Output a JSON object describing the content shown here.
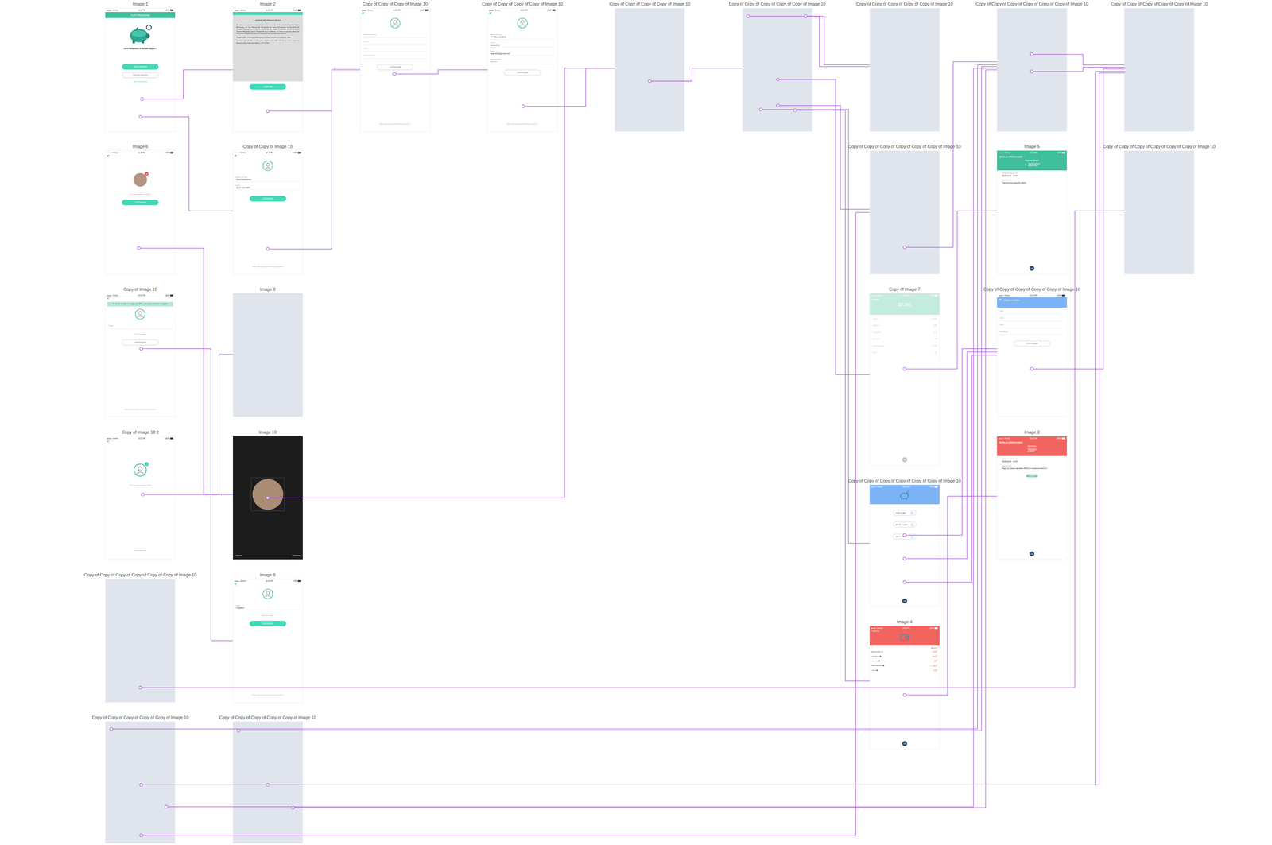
{
  "status_bar": {
    "carrier": "●●●●○ Verizon",
    "time": "10:22 PM",
    "battery": "100%"
  },
  "artboards": [
    {
      "title": "Image 1",
      "kind": "welcome",
      "header": "TUS FINANZAS",
      "tagline": "¡Tus finanzas, a donde vayas !",
      "primary": "REGISTRARSE",
      "secondary": "INICIAR SESIÓN",
      "link": "Aviso de privacidad"
    },
    {
      "title": "Image 2",
      "kind": "privacy",
      "heading": "AVISO DE PRIVACIDAD",
      "body": [
        "En cumplimiento a lo establecido por la Constitución Política de los Estados Unidos Mexicanos, la Ley General de Protección de Datos Personales en Posesión de Sujetos Obligados y la Ley de Protección de Datos Personales en Posesión de Sujetos Obligados para el Estado de Baja California, se emite el presente Aviso de Privacidad Simplificado, para el tratamiento de sus datos personales.",
        "Responsable: Universidad Autónoma de Baja California, en adelante UABC.",
        "Domicilio: Avenida Álvaro Obregón y Julián Carrillo S/N, Col. Nueva, en la ciudad de Mexicali, Baja California, México. C.P. 21100."
      ],
      "button": "ACEPTAR"
    },
    {
      "title": "Copy of Copy of Copy of Image 10",
      "kind": "form",
      "fields": [
        {
          "label": "Número de cliente",
          "value": ""
        },
        {
          "label": "Usuario",
          "value": ""
        },
        {
          "label": "Correo",
          "value": ""
        },
        {
          "label": "Crear contraseña",
          "value": ""
        }
      ],
      "button": "CONTINUAR",
      "button_filled": false,
      "footer": "Al dar continuar aceptas los términos y condiciones"
    },
    {
      "title": "Copy of Copy of Copy of Copy of Image 10",
      "kind": "form",
      "fields": [
        {
          "label": "Número de cliente",
          "value": "Y77786UH8098X5"
        },
        {
          "label": "Usuario",
          "value": "JDAlb0505"
        },
        {
          "label": "Correo",
          "value": "alejandrotr@gmail.com"
        },
        {
          "label": "Crear contraseña",
          "value": "• • • • • •"
        }
      ],
      "button": "CONTINUAR",
      "button_filled": false,
      "footer": "Al dar continuar aceptas los términos y condiciones"
    },
    {
      "title": "Copy of Copy of Copy of Copy of Image 10",
      "kind": "blank"
    },
    {
      "title": "Copy of Copy of Copy of Copy of Copy of Image 10",
      "kind": "blank"
    },
    {
      "title": "Copy of Copy of Copy of Copy of Copy of Image 10",
      "kind": "blank"
    },
    {
      "title": "Copy of Copy of Copy of Copy of Copy of Copy of Image 10",
      "kind": "blank"
    },
    {
      "title": "Copy of Copy of Copy of Copy of Copy of Image 10",
      "kind": "blank"
    },
    {
      "title": "Image 6",
      "kind": "photo",
      "badge": "×",
      "caption": "Toca para cambiar tu imagen",
      "button": "CONTINUAR"
    },
    {
      "title": "Copy of Copy of Image 10",
      "kind": "form",
      "fields": [
        {
          "label": "Número de cliente",
          "value": "YE5678665653AC"
        },
        {
          "label": "Celular",
          "value": "+52 6 7123 4567"
        }
      ],
      "button": "CONTINUAR",
      "button_filled": true,
      "footer": "Al dar continuar aceptas los términos y condiciones"
    },
    {
      "title": "Copy of Copy of Copy of Copy of Copy of Copy of Image 10",
      "kind": "blank"
    },
    {
      "title": "Image 5",
      "kind": "detail",
      "color": "#3fbf9c",
      "heading": "DETALLE OPERACIONES",
      "name": "Pago de Salario",
      "amount": "+ 3060",
      "cents": "00",
      "rows": [
        {
          "label": "FECHA DE OPERACIÓN",
          "value": "06/08/2018 - 23:56"
        },
        {
          "label": "DESCRIPCIÓN",
          "value": "Transferencia pago de salario"
        }
      ],
      "menu": "•••"
    },
    {
      "title": "Copy of Copy of Copy of Copy of Copy of Copy of Image 10",
      "kind": "blank"
    },
    {
      "title": "Copy of Image 10",
      "kind": "form",
      "toast": "Te hemos enviado un código por SMS, úsalo para completar tu registro",
      "fields": [
        {
          "label": "Código",
          "value": ""
        }
      ],
      "resend": "Reenviar código",
      "button": "CONTINUAR",
      "button_filled": false,
      "footer": "Al dar continuar aceptas los términos y condiciones"
    },
    {
      "title": "Image 8",
      "kind": "blank"
    },
    {
      "title": "Copy of Image 7",
      "kind": "account",
      "faded": true,
      "color": "#3fbf9c",
      "heading": "SALDO",
      "balance": "$2,350",
      "rows": [
        {
          "label": "Salario",
          "value": "+ 3,060"
        },
        {
          "label": "Starbucks",
          "value": "– 299"
        },
        {
          "label": "Transporte",
          "value": "– 513"
        },
        {
          "label": "Servicios",
          "value": "– 99"
        },
        {
          "label": "Subscripciones",
          "value": "– 1,182"
        },
        {
          "label": "Otros",
          "value": "– 99"
        }
      ],
      "menu": "•••"
    },
    {
      "title": "Copy of Copy of Copy of Copy of Copy of Image 10",
      "kind": "form",
      "header": "NUEVO AHORRO",
      "color": "#7cb2f6",
      "fields": [
        {
          "label": "Título",
          "value": ""
        },
        {
          "label": "Monto",
          "value": ""
        },
        {
          "label": "Plazo",
          "value": ""
        },
        {
          "label": "Descripción",
          "value": ""
        }
      ],
      "button": "CONTINUAR",
      "button_filled": false
    },
    {
      "title": "Copy of Image 10 2",
      "kind": "addphoto",
      "badge": "+",
      "caption": "Toca el + para agregar tu foto",
      "later": "Hacerlo más tarde"
    },
    {
      "title": "Image 10",
      "kind": "camera",
      "cancel": "Cancel",
      "confirm": "Continue"
    },
    {
      "title": "Image 3",
      "kind": "detail",
      "color": "#f2645f",
      "heading": "DETALLE OPERACIONES",
      "name": "Starbucks",
      "amount": "299",
      "cents": "00",
      "rows": [
        {
          "label": "FECHA DE OPERACIÓN",
          "value": "06/08/2018 - 16:06"
        },
        {
          "label": "DESCRIPCIÓN",
          "value": "Pago con tarjeta de débito #5642 en Starbucks Metro 5"
        }
      ],
      "action": "Reportar",
      "menu": "•••"
    },
    {
      "title": "Copy of Copy of Copy of Copy of Copy of Copy of Image 10",
      "kind": "plans",
      "color": "#7cb2f6",
      "options": [
        "CORTO PLAZO",
        "MEDIANO PLAZO",
        "LARGO PLAZO"
      ],
      "menu": "•••"
    },
    {
      "title": "Image 4",
      "kind": "expenses",
      "color": "#f2645f",
      "heading": "GASTOS",
      "month": "Agosto ▾",
      "items": [
        {
          "label": "Alimentación",
          "amount": "– 299",
          "cents": "00",
          "color": "#f5a623"
        },
        {
          "label": "Transporte",
          "amount": "– 513",
          "cents": "00",
          "color": "#c0392b"
        },
        {
          "label": "Servicios",
          "amount": "– 99",
          "cents": "00",
          "color": "#7f8c8d"
        },
        {
          "label": "Subscripciones",
          "amount": "– 1,182",
          "cents": "00",
          "color": "#8e6b3e"
        },
        {
          "label": "Otros",
          "amount": "– 99",
          "cents": "00",
          "color": "#2e9e4f"
        }
      ],
      "menu": "•••"
    },
    {
      "title": "Copy of Copy of Copy of Copy of Copy of Copy of Image 10",
      "kind": "blank"
    },
    {
      "title": "Image 9",
      "kind": "form",
      "fields": [
        {
          "label": "Código",
          "value": "Y7E5B4O"
        }
      ],
      "resend": "Reenviar código",
      "button": "CONTINUAR",
      "button_filled": true,
      "footer": "Al dar continuar aceptas los términos y condiciones"
    },
    {
      "title": "Copy of Copy of Copy of Copy of Copy of Image 10",
      "kind": "blank"
    },
    {
      "title": "Copy of Copy of Copy of Copy of Copy of Image 10",
      "kind": "blank"
    }
  ],
  "links": [
    {
      "from": "Image 1",
      "to": "Image 2"
    },
    {
      "from": "Image 1",
      "to": "Copy of Copy of Image 10"
    },
    {
      "from": "Image 2",
      "to": "Copy of Copy of Copy of Image 10"
    },
    {
      "from": "Copy of Copy of Copy of Image 10",
      "to": "Copy of Copy of Copy of Copy of Image 10"
    },
    {
      "from": "Copy of Copy of Copy of Copy of Image 10",
      "to": "Copy of Copy of Copy of Copy of Image 10"
    },
    {
      "from": "Image 6",
      "to": "Image 10"
    },
    {
      "from": "Copy of Copy of Image 10",
      "to": "Copy of Copy of Copy of Image 10"
    },
    {
      "from": "Copy of Image 10",
      "to": "Image 9"
    },
    {
      "from": "Copy of Image 10 2",
      "to": "Image 8"
    },
    {
      "from": "Image 10",
      "to": "Copy of Copy of Copy of Copy of Image 10"
    },
    {
      "from": "Copy of Copy of Copy of Copy of Image 10",
      "to": "Copy of Copy of Copy of Copy of Copy of Image 10"
    },
    {
      "from": "Copy of Copy of Copy of Copy of Copy of Image 10",
      "to": "Copy of Copy of Copy of Copy of Copy of Image 10"
    },
    {
      "from": "Copy of Copy of Copy of Copy of Copy of Image 10",
      "to": "Copy of Copy of Copy of Copy of Copy of Image 10"
    },
    {
      "from": "Copy of Copy of Copy of Copy of Copy of Image 10",
      "to": "Copy of Image 7"
    },
    {
      "from": "Copy of Copy of Copy of Copy of Copy of Image 10",
      "to": "Copy of Copy of Copy of Copy of Copy of Copy of Image 10"
    },
    {
      "from": "Copy of Copy of Copy of Copy of Copy of Image 10",
      "to": "Copy of Copy of Copy of Copy of Copy of Copy of Image 10"
    },
    {
      "from": "Copy of Copy of Copy of Copy of Copy of Image 10",
      "to": "Image 4"
    },
    {
      "from": "Copy of Copy of Copy of Copy of Copy of Copy of Image 10",
      "to": "Copy of Copy of Copy of Copy of Copy of Image 10"
    },
    {
      "from": "Copy of Copy of Copy of Copy of Copy of Copy of Image 10",
      "to": "Copy of Copy of Copy of Copy of Copy of Image 10"
    },
    {
      "from": "Copy of Copy of Copy of Copy of Copy of Copy of Image 10",
      "to": "Copy of Copy of Copy of Copy of Copy of Copy of Image 10"
    },
    {
      "from": "Copy of Image 7",
      "to": "Image 5"
    },
    {
      "from": "Copy of Copy of Copy of Copy of Copy of Image 10",
      "to": "Copy of Copy of Copy of Copy of Copy of Image 10"
    },
    {
      "from": "Copy of Copy of Copy of Copy of Copy of Copy of Image 10",
      "to": "Copy of Copy of Copy of Copy of Copy of Image 10"
    },
    {
      "from": "Copy of Copy of Copy of Copy of Copy of Copy of Image 10",
      "to": "Copy of Copy of Copy of Copy of Copy of Image 10"
    },
    {
      "from": "Copy of Copy of Copy of Copy of Copy of Copy of Image 10",
      "to": "Copy of Copy of Copy of Copy of Copy of Image 10"
    },
    {
      "from": "Image 4",
      "to": "Image 3"
    },
    {
      "from": "Copy of Copy of Copy of Copy of Copy of Copy of Image 10",
      "to": "Copy of Copy of Copy of Copy of Copy of Copy of Image 10"
    },
    {
      "from": "Copy of Copy of Copy of Copy of Copy of Image 10",
      "to": "Copy of Copy of Copy of Copy of Copy of Copy of Image 10"
    },
    {
      "from": "Copy of Copy of Copy of Copy of Copy of Image 10",
      "to": "Copy of Copy of Copy of Copy of Copy of Copy of Image 10"
    },
    {
      "from": "Copy of Copy of Copy of Copy of Copy of Image 10",
      "to": "Copy of Copy of Copy of Copy of Copy of Image 10"
    },
    {
      "from": "Copy of Copy of Copy of Copy of Copy of Image 10",
      "to": "Copy of Copy of Copy of Copy of Copy of Image 10"
    },
    {
      "from": "Copy of Copy of Copy of Copy of Copy of Image 10",
      "to": "Copy of Copy of Copy of Copy of Copy of Copy of Image 10"
    },
    {
      "from": "Copy of Copy of Copy of Copy of Copy of Image 10",
      "to": "Copy of Copy of Copy of Copy of Copy of Copy of Image 10"
    },
    {
      "from": "Copy of Copy of Copy of Copy of Copy of Image 10",
      "to": "Copy of Copy of Copy of Copy of Copy of Copy of Image 10"
    }
  ]
}
